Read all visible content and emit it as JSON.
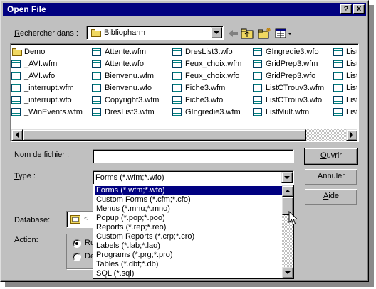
{
  "window": {
    "title": "Open File",
    "help_label": "?",
    "close_label": "X"
  },
  "look_in": {
    "label_underlined": "R",
    "label_rest": "echercher dans :",
    "value": "Bibliopharm"
  },
  "files": {
    "columns": [
      [
        "Demo",
        "_AVI.wfm",
        "_AVI.wfo",
        "_interrupt.wfm",
        "_interrupt.wfo",
        "_WinEvents.wfm"
      ],
      [
        "Attente.wfm",
        "Attente.wfo",
        "Bienvenu.wfm",
        "Bienvenu.wfo",
        "Copyright3.wfm",
        "DresList3.wfm"
      ],
      [
        "DresList3.wfo",
        "Feux_choix.wfm",
        "Feux_choix.wfo",
        "Fiche3.wfm",
        "Fiche3.wfo",
        "GIngredie3.wfm"
      ],
      [
        "GIngredie3.wfo",
        "GridPrep3.wfm",
        "GridPrep3.wfo",
        "ListCTrouv3.wfm",
        "ListCTrouv3.wfo",
        "ListMult.wfm"
      ],
      [
        "List",
        "List",
        "List",
        "List",
        "List",
        "List"
      ]
    ]
  },
  "filename": {
    "label_start": "No",
    "label_underlined": "m",
    "label_rest": " de fichier :",
    "value": ""
  },
  "type": {
    "label_underlined": "T",
    "label_rest": "ype :",
    "value": "Forms (*.wfm;*.wfo)",
    "options": [
      "Forms (*.wfm;*.wfo)",
      "Custom Forms (*.cfm;*.cfo)",
      "Menus (*.mnu;*.mno)",
      "Popup (*.pop;*.poo)",
      "Reports (*.rep;*.reo)",
      "Custom Reports (*.crp;*.cro)",
      "Labels (*.lab;*.lao)",
      "Programs (*.prg;*.pro)",
      "Tables (*.dbf;*.db)",
      "SQL (*.sql)"
    ],
    "selected_index": 0
  },
  "database": {
    "label": "Database:",
    "value": "<"
  },
  "action": {
    "label": "Action:",
    "options": [
      "Ru",
      "De"
    ]
  },
  "buttons": {
    "open_underlined": "O",
    "open_rest": "uvrir",
    "cancel": "Annuler",
    "help_underlined": "A",
    "help_rest": "ide"
  },
  "colors": {
    "titlebar": "#000080",
    "face": "#c0c0c0",
    "selection": "#000080"
  }
}
